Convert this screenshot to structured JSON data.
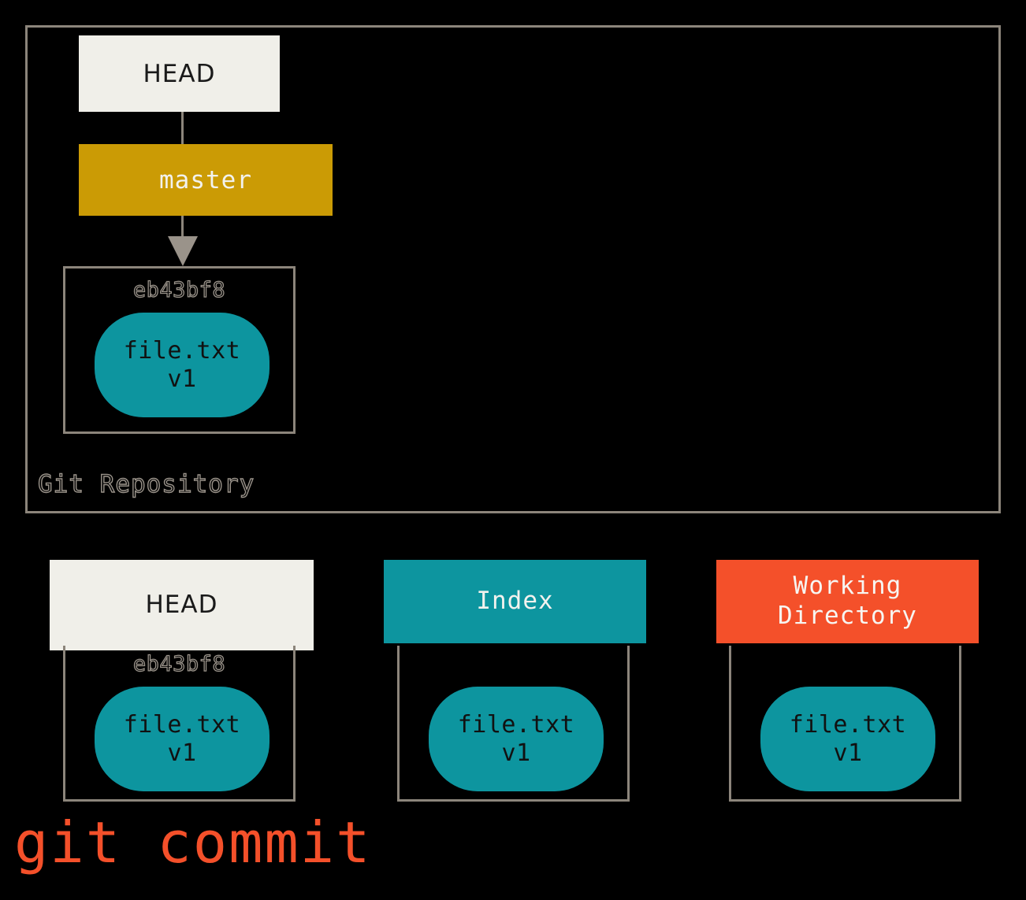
{
  "caption": "git commit",
  "colors": {
    "background": "#000000",
    "cream": "#f0efe9",
    "gold": "#cb9b05",
    "teal": "#0d959f",
    "orange_red": "#f4502a",
    "grey_border": "#8c857b",
    "grey_text": "#9a938a"
  },
  "repository": {
    "label": "Git Repository",
    "head_ref": "HEAD",
    "branch_ref": "master",
    "commit": {
      "hash": "eb43bf8",
      "blob": {
        "filename": "file.txt",
        "version": "v1"
      }
    }
  },
  "areas": [
    {
      "id": "head",
      "title": "HEAD",
      "title_line2": "",
      "hash": "eb43bf8",
      "blob": {
        "filename": "file.txt",
        "version": "v1"
      }
    },
    {
      "id": "index",
      "title": "Index",
      "title_line2": "",
      "hash": "",
      "blob": {
        "filename": "file.txt",
        "version": "v1"
      }
    },
    {
      "id": "working-directory",
      "title": "Working",
      "title_line2": "Directory",
      "hash": "",
      "blob": {
        "filename": "file.txt",
        "version": "v1"
      }
    }
  ]
}
